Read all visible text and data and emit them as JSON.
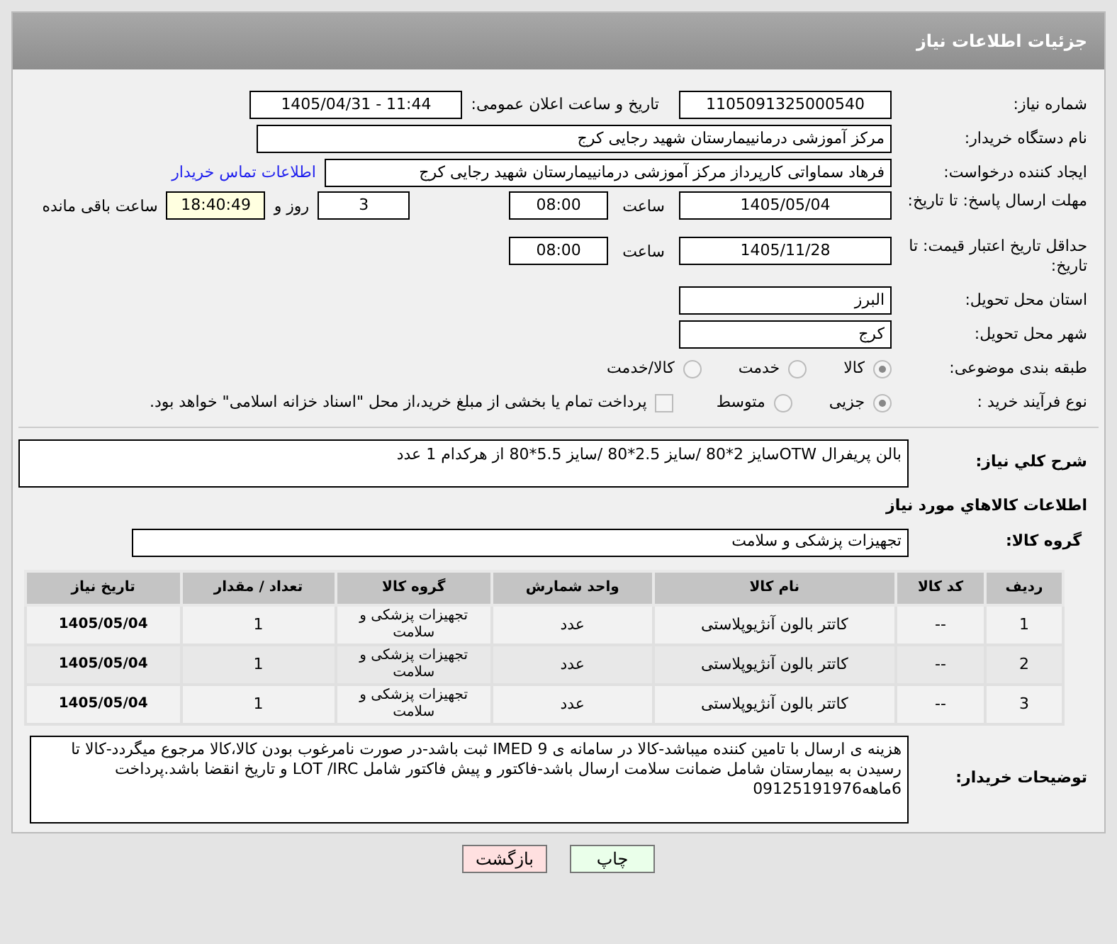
{
  "header": {
    "title": "جزئیات اطلاعات نیاز"
  },
  "need_number": {
    "label": "شماره نیاز:",
    "value": "1105091325000540"
  },
  "announce": {
    "label": "تاریخ و ساعت اعلان عمومی:",
    "value": "1405/04/31 - 11:44"
  },
  "buyer_org": {
    "label": "نام دستگاه خریدار:",
    "value": "مرکز آموزشی درمانییمارستان شهید رجایی کرج"
  },
  "requester": {
    "label": "ایجاد کننده درخواست:",
    "value": "فرهاد سماواتی کارپرداز مرکز آموزشی درمانییمارستان شهید رجایی کرج",
    "link": "اطلاعات تماس خریدار"
  },
  "reply_deadline": {
    "label": "مهلت ارسال پاسخ: تا تاریخ:",
    "date": "1405/05/04",
    "time_label": "ساعت",
    "time": "08:00",
    "days": "3",
    "days_label": "روز و",
    "remaining": "18:40:49",
    "remaining_label": "ساعت باقی مانده"
  },
  "price_validity": {
    "label": "حداقل تاریخ اعتبار قیمت: تا تاریخ:",
    "date": "1405/11/28",
    "time_label": "ساعت",
    "time": "08:00"
  },
  "province": {
    "label": "استان محل تحویل:",
    "value": "البرز"
  },
  "city": {
    "label": "شهر محل تحویل:",
    "value": "کرج"
  },
  "category": {
    "label": "طبقه بندی موضوعی:",
    "options": [
      {
        "label": "کالا",
        "selected": true
      },
      {
        "label": "خدمت",
        "selected": false
      },
      {
        "label": "کالا/خدمت",
        "selected": false
      }
    ]
  },
  "purchase_type": {
    "label": "نوع فرآیند خرید :",
    "options": [
      {
        "label": "جزیی",
        "selected": true
      },
      {
        "label": "متوسط",
        "selected": false
      }
    ],
    "payment": {
      "label": "پرداخت تمام یا بخشی از مبلغ خرید،از محل \"اسناد خزانه اسلامی\" خواهد بود.",
      "checked": false
    }
  },
  "description": {
    "label": "شرح کلي نياز:",
    "value": "بالن پریفرال OTWسایز 2*80 /سایز 2.5*80 /سایز 5.5*80  از هرکدام 1 عدد"
  },
  "goods_title": "اطلاعات کالاهاي مورد نياز",
  "goods_group": {
    "label": "گروه کالا:",
    "value": "تجهیزات پزشکی و سلامت"
  },
  "table": {
    "columns": [
      "ردیف",
      "کد کالا",
      "نام کالا",
      "واحد شمارش",
      "گروه کالا",
      "تعداد / مقدار",
      "تاریخ نیاز"
    ],
    "rows": [
      [
        "1",
        "--",
        "کاتتر بالون آنژیوپلاستی",
        "عدد",
        "تجهیزات پزشکی و سلامت",
        "1",
        "1405/05/04"
      ],
      [
        "2",
        "--",
        "کاتتر بالون آنژیوپلاستی",
        "عدد",
        "تجهیزات پزشکی و سلامت",
        "1",
        "1405/05/04"
      ],
      [
        "3",
        "--",
        "کاتتر بالون آنژیوپلاستی",
        "عدد",
        "تجهیزات پزشکی و سلامت",
        "1",
        "1405/05/04"
      ]
    ]
  },
  "buyer_notes": {
    "label": "توضیحات خریدار:",
    "value": "هزینه ی ارسال با تامین کننده میباشد-کالا در سامانه ی IMED 9 ثبت باشد-در صورت نامرغوب بودن کالا،کالا مرجوع میگردد-کالا تا رسیدن به بیمارستان شامل ضمانت سلامت ارسال باشد-فاکتور و پیش فاکتور شامل LOT /IRC و تاریخ انقضا باشد.پرداخت 6ماهه09125191976"
  },
  "buttons": [
    {
      "label": "چاپ",
      "kind": "print"
    },
    {
      "label": "بازگشت",
      "kind": "back"
    }
  ]
}
